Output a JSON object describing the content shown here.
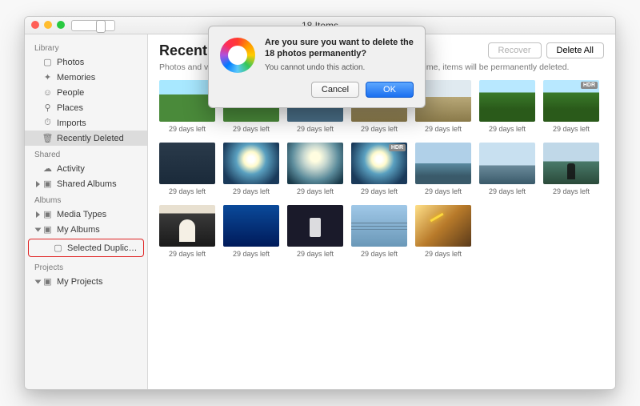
{
  "titlebar": {
    "title": "18 Items"
  },
  "sidebar": {
    "sections": {
      "library": {
        "header": "Library",
        "items": [
          "Photos",
          "Memories",
          "People",
          "Places",
          "Imports",
          "Recently Deleted"
        ]
      },
      "shared": {
        "header": "Shared",
        "items": [
          "Activity",
          "Shared Albums"
        ]
      },
      "albums": {
        "header": "Albums",
        "items": [
          "Media Types",
          "My Albums",
          "Selected Duplicate Photos"
        ]
      },
      "projects": {
        "header": "Projects",
        "items": [
          "My Projects"
        ]
      }
    }
  },
  "header": {
    "title": "Recently Deleted",
    "subtitle": "Photos and videos show the days remaining before deletion. After that time, items will be permanently deleted.",
    "recover": "Recover",
    "deleteAll": "Delete All"
  },
  "grid": {
    "caption": "29 days left",
    "hdr": "HDR",
    "rows": [
      [
        {
          "c": "green"
        },
        {
          "c": "green"
        },
        {
          "c": "sky1"
        },
        {
          "c": "field"
        },
        {
          "c": "field"
        },
        {
          "c": "green2"
        },
        {
          "c": "green2",
          "b": true
        }
      ],
      [
        {
          "c": "dark"
        },
        {
          "c": "sun"
        },
        {
          "c": "sun2"
        },
        {
          "c": "sun",
          "b": true
        },
        {
          "c": "beach"
        },
        {
          "c": "water"
        },
        {
          "c": "person"
        }
      ],
      [
        {
          "c": "arch"
        },
        {
          "c": "blue"
        },
        {
          "c": "darkp"
        },
        {
          "c": "wire"
        },
        {
          "c": "fly"
        }
      ]
    ]
  },
  "dialog": {
    "title": "Are you sure you want to delete the 18 photos permanently?",
    "body": "You cannot undo this action.",
    "cancel": "Cancel",
    "ok": "OK"
  }
}
